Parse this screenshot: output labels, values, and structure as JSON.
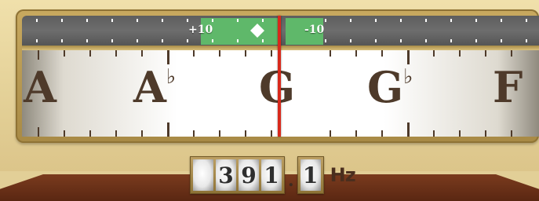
{
  "meter": {
    "sharp_label": "+10",
    "flat_label": "-10",
    "in_tune_color": "#5fb86a",
    "needle_color": "#d8291c",
    "indicator_icon": "diamond-icon"
  },
  "scale": {
    "notes": [
      {
        "letter": "A",
        "accidental": ""
      },
      {
        "letter": "A",
        "accidental": "♭"
      },
      {
        "letter": "G",
        "accidental": ""
      },
      {
        "letter": "G",
        "accidental": "♭"
      },
      {
        "letter": "F",
        "accidental": ""
      }
    ]
  },
  "frequency": {
    "digits": [
      "",
      "3",
      "9",
      "1"
    ],
    "decimal_separator": ".",
    "decimal": "1",
    "unit": "Hz"
  }
}
